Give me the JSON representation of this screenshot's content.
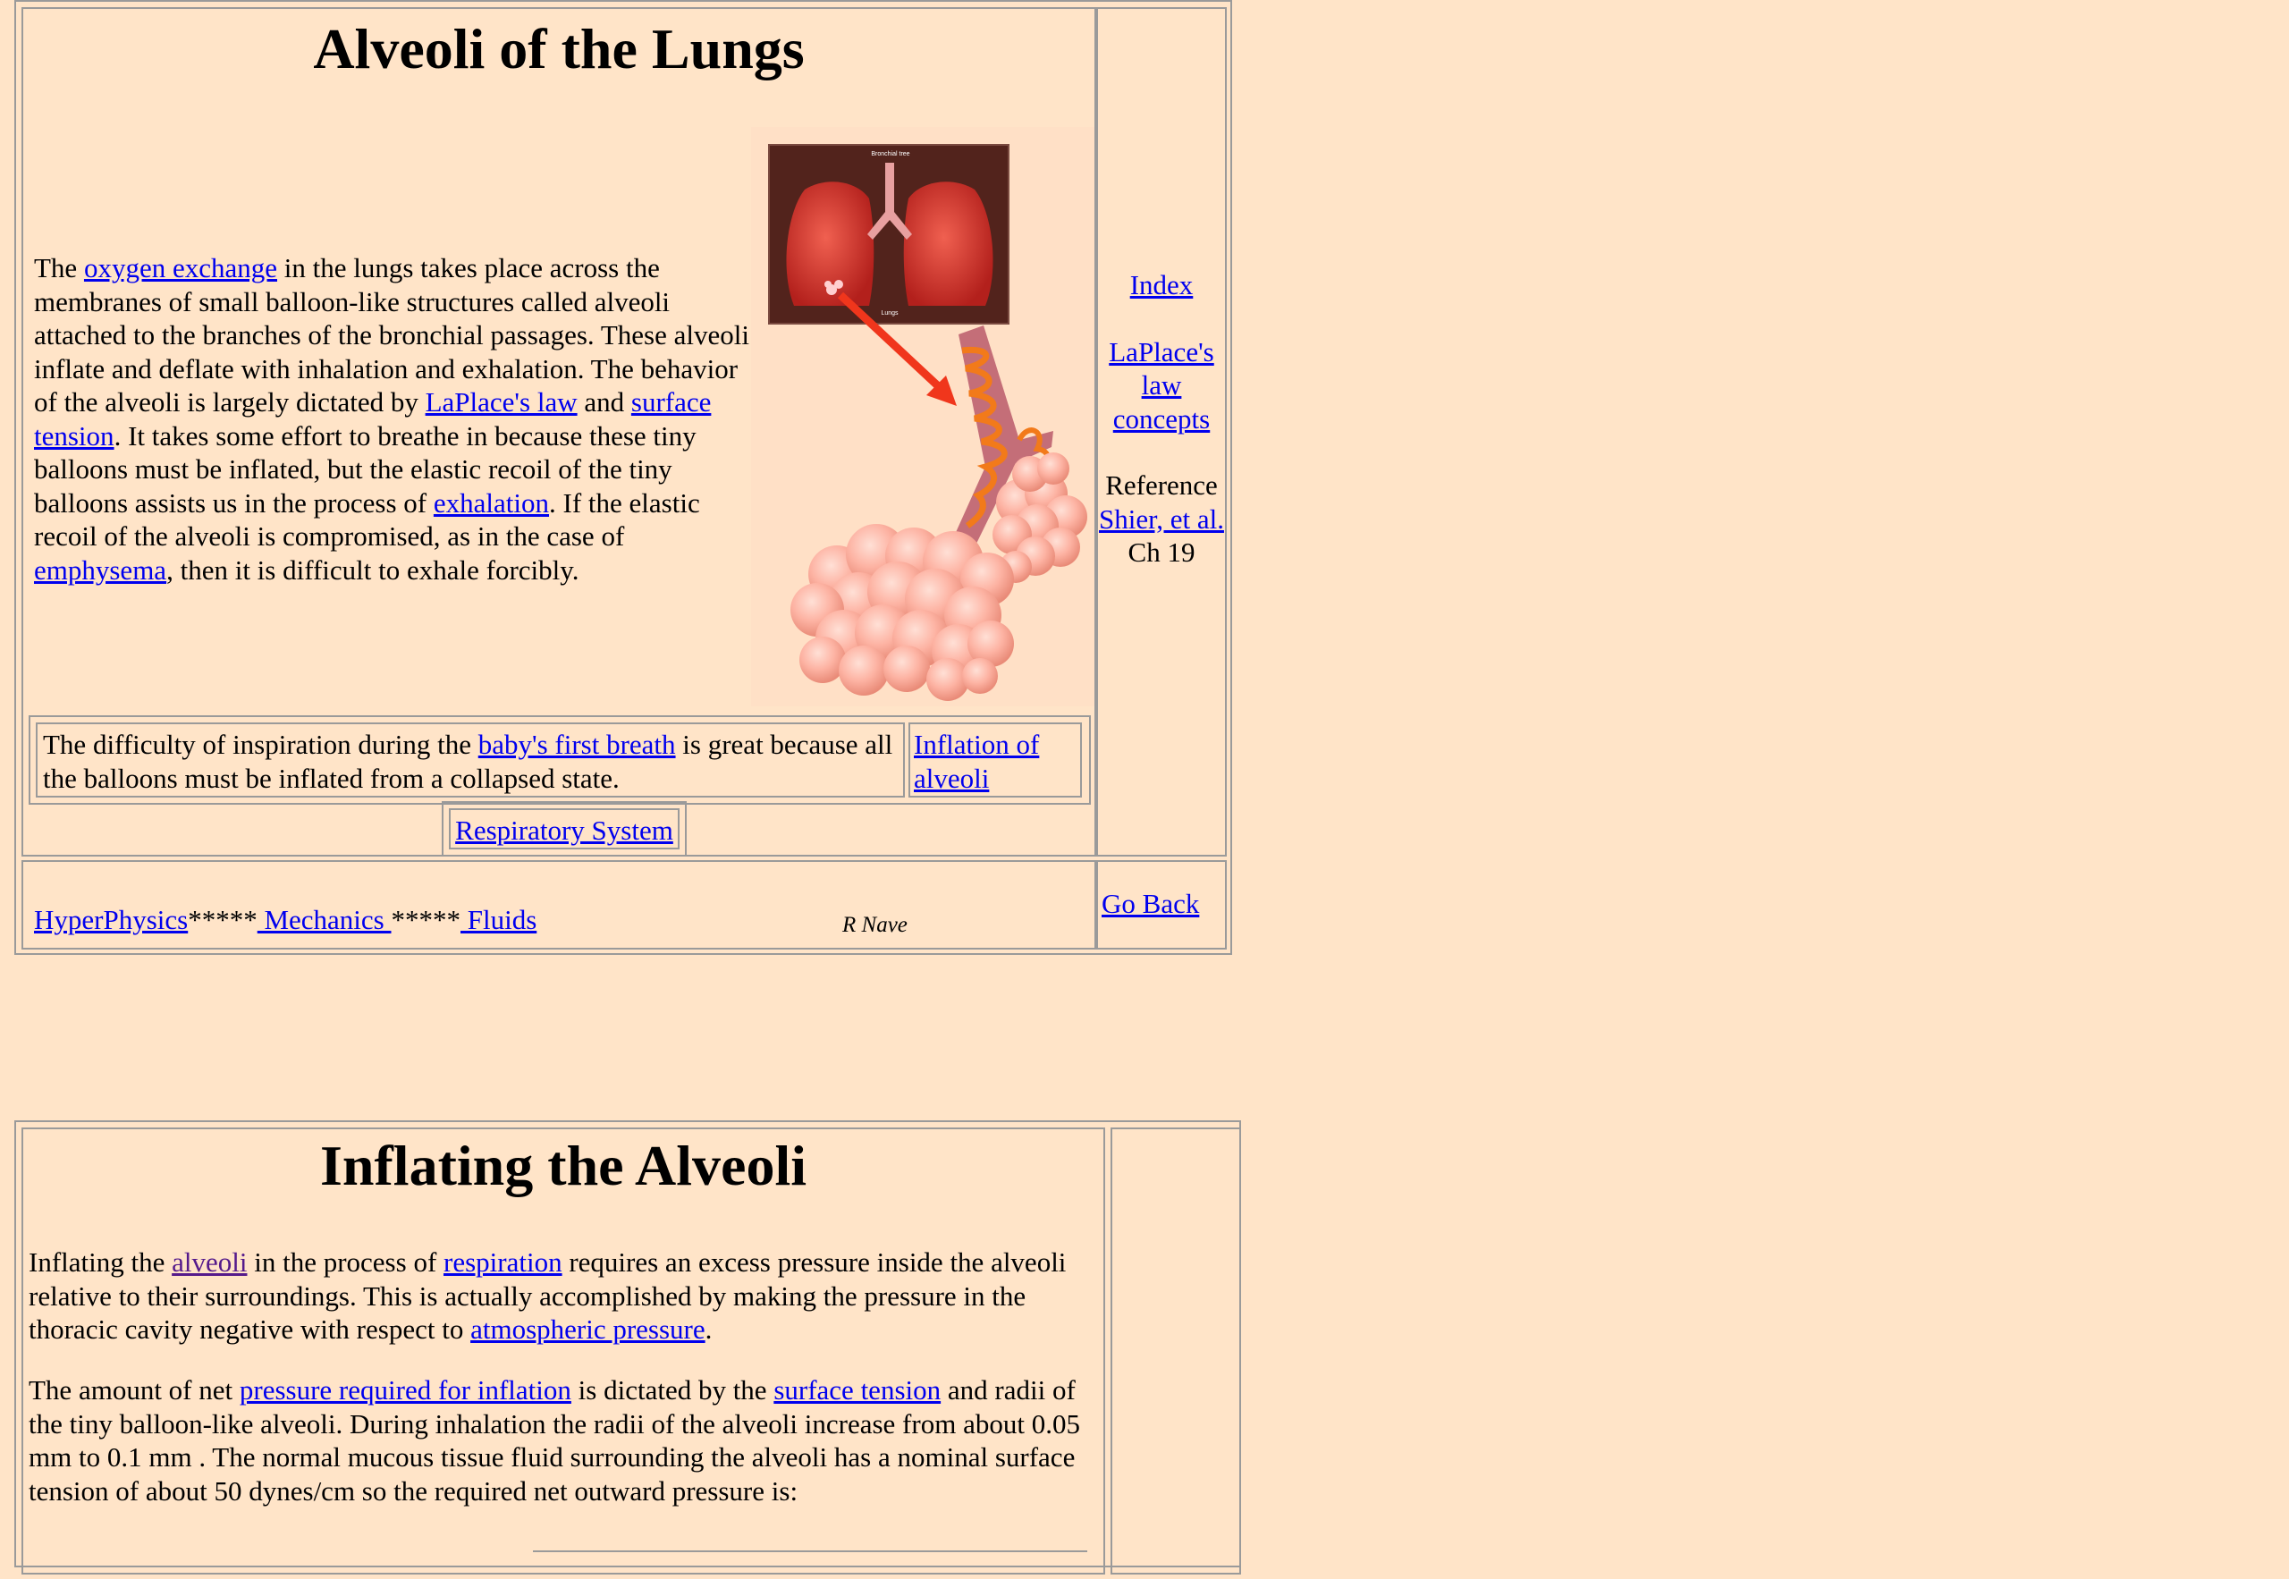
{
  "section1": {
    "title": "Alveoli of the Lungs",
    "intro": {
      "t1": "The ",
      "link_oxygen": "oxygen exchange",
      "t2": " in the lungs takes place across the membranes of small balloon-like structures called alveoli attached to the branches of the bronchial passages. These alveoli inflate and deflate with inhalation and exhalation. The behavior of the alveoli is largely dictated by ",
      "link_laplace": "LaPlace's law",
      "t3": " and ",
      "link_surface": "surface tension",
      "t4": ". It takes some effort to breathe in because these tiny balloons must be inflated, but the elastic recoil of the tiny balloons assists us in the process of ",
      "link_exhalation": "exhalation",
      "t5": ". If the elastic recoil of the alveoli is compromised, as in the case of ",
      "link_emphysema": "emphysema",
      "t6": ", then it is difficult to exhale forcibly."
    },
    "diagram": {
      "label_bronchial": "Bronchial tree",
      "label_lungs": "Lungs"
    },
    "baby": {
      "t1": "The difficulty of inspiration during the ",
      "link_baby": "baby's first breath",
      "t2": " is great because all the balloons must be inflated from a collapsed state."
    },
    "link_inflation": "Inflation of alveoli",
    "link_respiratory": "Respiratory System",
    "side": {
      "index": "Index",
      "laplace_concepts": "LaPlace's law concepts",
      "reference_label": "Reference",
      "shier": "Shier, et al.",
      "chapter": "Ch 19"
    },
    "footer": {
      "hyperphysics": "HyperPhysics",
      "stars1": "*****",
      "mechanics": " Mechanics ",
      "stars2": "*****",
      "fluids": " Fluids",
      "author": "R Nave",
      "go_back": "Go Back"
    }
  },
  "section2": {
    "title": "Inflating the Alveoli",
    "p1": {
      "t1": "Inflating the ",
      "link_alveoli": "alveoli",
      "t2": " in the process of ",
      "link_respiration": "respiration",
      "t3": " requires an excess pressure inside the alveoli relative to their surroundings. This is actually accomplished by making the pressure in the thoracic cavity negative with respect to ",
      "link_atm": "atmospheric pressure",
      "t4": "."
    },
    "p2": {
      "t1": "The amount of net ",
      "link_pressure": "pressure required for inflation",
      "t2": " is dictated by the ",
      "link_surface": "surface tension",
      "t3": " and radii of the tiny balloon-like alveoli. During inhalation the radii of the alveoli increase from about 0.05 mm to 0.1 mm . The normal mucous tissue fluid surrounding the alveoli has a nominal surface tension of about 50 dynes/cm so the required net outward pressure is:"
    }
  },
  "colors": {
    "background": "#ffe4c8",
    "link": "#0000ee",
    "visited": "#551a8b",
    "border": "#9a9a9a"
  }
}
